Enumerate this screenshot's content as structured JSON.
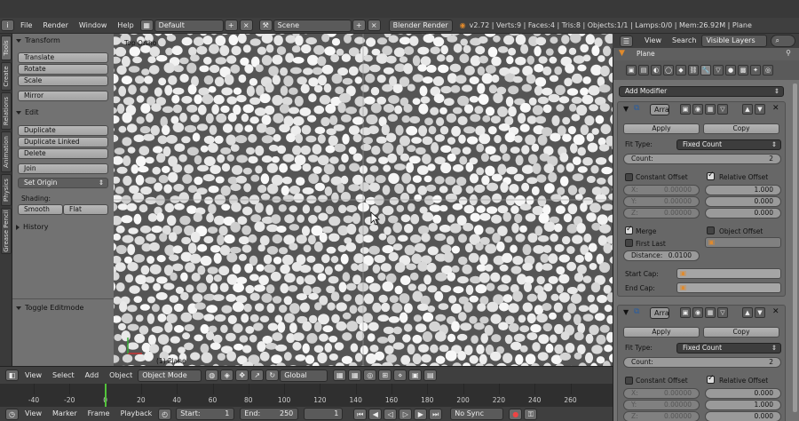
{
  "topbar": {
    "menus": [
      "File",
      "Render",
      "Window",
      "Help"
    ],
    "layout_value": "Default",
    "scene_value": "Scene",
    "engine_value": "Blender Render",
    "stats": "v2.72 | Verts:9 | Faces:4 | Tris:8 | Objects:1/1 | Lamps:0/0 | Mem:26.92M | Plane"
  },
  "tabs": [
    "Tools",
    "Create",
    "Relations",
    "Animation",
    "Physics",
    "Grease Pencil"
  ],
  "shelf": {
    "transform_head": "Transform",
    "translate": "Translate",
    "rotate": "Rotate",
    "scale": "Scale",
    "mirror": "Mirror",
    "edit_head": "Edit",
    "duplicate": "Duplicate",
    "duplicate_linked": "Duplicate Linked",
    "delete": "Delete",
    "join": "Join",
    "set_origin": "Set Origin",
    "shading_label": "Shading:",
    "smooth": "Smooth",
    "flat": "Flat",
    "history_head": "History",
    "toggle_editmode": "Toggle Editmode"
  },
  "viewport": {
    "top_label": "Top Ortho",
    "bottom_label": "(1) Plane"
  },
  "view_header": {
    "menus": [
      "View",
      "Select",
      "Add",
      "Object"
    ],
    "mode": "Object Mode",
    "orientation": "Global"
  },
  "timeline": {
    "ticks": [
      "-40",
      "-20",
      "0",
      "20",
      "40",
      "60",
      "80",
      "100",
      "120",
      "140",
      "160",
      "180",
      "200",
      "220",
      "240",
      "260"
    ],
    "menus": [
      "View",
      "Marker",
      "Frame",
      "Playback"
    ],
    "start_label": "Start:",
    "start_value": "1",
    "end_label": "End:",
    "end_value": "250",
    "current_frame": "1",
    "sync": "No Sync"
  },
  "props_top": {
    "view": "View",
    "search": "Search",
    "filter": "Visible Layers",
    "object_name": "Plane"
  },
  "properties": {
    "add_modifier": "Add Modifier",
    "modifiers": [
      {
        "name": "Arra",
        "apply": "Apply",
        "copy": "Copy",
        "fit_type_label": "Fit Type:",
        "fit_type": "Fixed Count",
        "count_label": "Count:",
        "count": "2",
        "constant_offset": "Constant Offset",
        "relative_offset": "Relative Offset",
        "cx_label": "X:",
        "cx": "0.00000",
        "cy_label": "Y:",
        "cy": "0.00000",
        "cz_label": "Z:",
        "cz": "0.00000",
        "rx": "1.000",
        "ry": "0.000",
        "rz": "0.000",
        "merge": "Merge",
        "first_last": "First Last",
        "object_offset": "Object Offset",
        "distance_label": "Distance:",
        "distance": "0.0100",
        "start_cap": "Start Cap:",
        "end_cap": "End Cap:"
      },
      {
        "name": "Arra",
        "apply": "Apply",
        "copy": "Copy",
        "fit_type_label": "Fit Type:",
        "fit_type": "Fixed Count",
        "count_label": "Count:",
        "count": "2",
        "constant_offset": "Constant Offset",
        "relative_offset": "Relative Offset",
        "cx_label": "X:",
        "cx": "0.00000",
        "cy_label": "Y:",
        "cy": "0.00000",
        "cz_label": "Z:",
        "cz": "0.00000",
        "rx": "0.000",
        "ry": "1.000",
        "rz": "0.000"
      }
    ]
  },
  "colors": {
    "header": "#3f3f3f",
    "panel": "#727272",
    "timeline_cursor": "#52c33a",
    "viewport_cell": "#e8e8e8",
    "viewport_gap": "#555555"
  }
}
